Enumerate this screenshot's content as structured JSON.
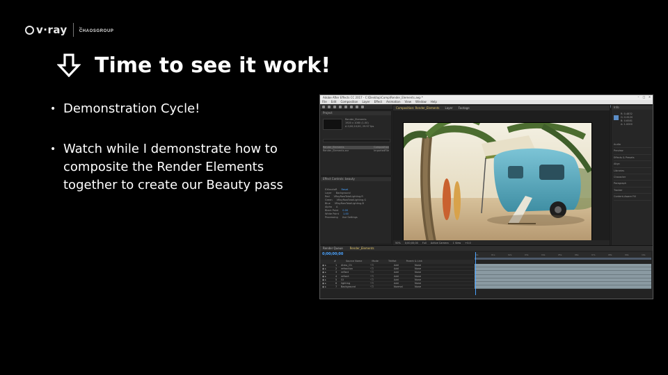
{
  "logo": {
    "brand": "v·ray",
    "by": "by",
    "company": "CHAOSGROUP"
  },
  "title": {
    "icon": "arrow-down-icon",
    "text": "Time to see it work!"
  },
  "bullets": [
    "Demonstration Cycle!",
    "Watch while I demonstrate how to composite the Render Elements together to create our Beauty pass"
  ],
  "screenshot": {
    "titlebar_text": "Adobe After Effects CC 2017 - C:\\Desktop\\Comp\\Render_Elements.aep *",
    "menu": [
      "File",
      "Edit",
      "Composition",
      "Layer",
      "Effect",
      "Animation",
      "View",
      "Window",
      "Help"
    ],
    "workspaces": [
      "Essentials",
      "Default",
      "Standard"
    ],
    "project_panel": {
      "title": "Project",
      "info": [
        "Render_Elements",
        "1920 x 1080 (1.00)",
        "Δ 0;00;10;00, 29.97 fps"
      ],
      "rows": [
        {
          "name": "Render_Elements",
          "type": "Composition"
        },
        {
          "name": "Render_Elements.exr",
          "type": "ImportedFile"
        }
      ]
    },
    "effects_panel": {
      "title": "Effect Controls: beauty",
      "lines": [
        {
          "label": "EXtractoR",
          "value": "Reset"
        },
        {
          "label": "Layer",
          "value": "Background"
        },
        {
          "label": "Red",
          "value": "VRayRawTotalLighting.R"
        },
        {
          "label": "Green",
          "value": "VRayRawTotalLighting.G"
        },
        {
          "label": "Blue",
          "value": "VRayRawTotalLighting.B"
        },
        {
          "label": "Alpha",
          "value": "A"
        },
        {
          "label": "Black Point",
          "value": "0.00"
        },
        {
          "label": "White Point",
          "value": "1.00"
        },
        {
          "label": "Processing",
          "value": "Use Settings"
        }
      ]
    },
    "comp_panel": {
      "tabs": [
        "Composition: Render_Elements",
        "Layer",
        "Footage"
      ],
      "footer": [
        "50%",
        "0;00;00;00",
        "Full",
        "Active Camera",
        "1 View",
        "+0.0"
      ]
    },
    "info_panel": {
      "title": "Info",
      "values": [
        "R: 0.4832",
        "G: 0.6120",
        "B: 0.6581",
        "A: 1.0000"
      ],
      "items": [
        "Audio",
        "Preview",
        "Effects & Presets",
        "Align",
        "Libraries",
        "Character",
        "Paragraph",
        "Tracker",
        "Content-Aware Fill"
      ]
    },
    "timeline": {
      "tabs": [
        "Render Queue",
        "Render_Elements"
      ],
      "timecode": "0;00;00;00",
      "columns": [
        "#",
        "Source Name",
        "Mode",
        "TrkMat",
        "Parent & Link"
      ],
      "layers": [
        {
          "num": "1",
          "name": "Atmo_Ch",
          "mode": "Add",
          "trk": "None"
        },
        {
          "num": "2",
          "name": "refraction",
          "mode": "Add",
          "trk": "None"
        },
        {
          "num": "3",
          "name": "reflect",
          "mode": "Add",
          "trk": "None"
        },
        {
          "num": "4",
          "name": "refract",
          "mode": "Add",
          "trk": "None"
        },
        {
          "num": "5",
          "name": "GI",
          "mode": "Add",
          "trk": "None"
        },
        {
          "num": "6",
          "name": "lighting",
          "mode": "Add",
          "trk": "None"
        },
        {
          "num": "7",
          "name": "Background",
          "mode": "Normal",
          "trk": "None"
        }
      ],
      "ruler": [
        "0s",
        "01s",
        "02s",
        "03s",
        "04s",
        "05s",
        "06s",
        "07s",
        "08s",
        "09s",
        "10s"
      ]
    }
  },
  "colors": {
    "background": "#000000",
    "text": "#ffffff",
    "ae_accent": "#4aa3ff"
  }
}
